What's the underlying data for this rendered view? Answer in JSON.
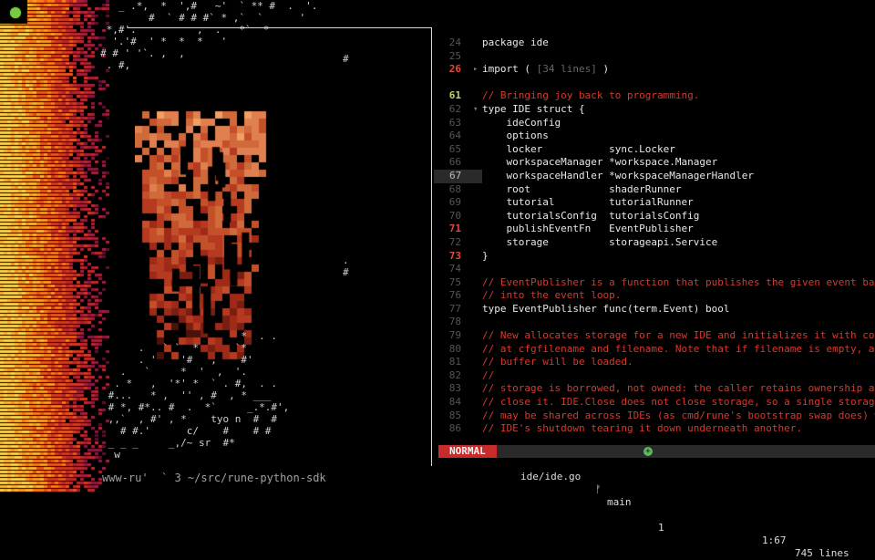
{
  "ascii_art": {
    "top": "   _ .*,  *  ',#   ~'  ` ** #  .  '.\n        #  ` # # #` * ,`  `      '\n *,#'.          ,  .   *`  *\n  '.'#  ' *  *  *   '\n# # ' '`. ,  ,\n . #,",
    "right": "#\n\n\n\n\n\n\n\n\n\n\n\n\n\n\n\n\n.\n#",
    "bottom": "                       *  . .\n      .   ` `  *      `*\n      . '    '#   ,    #'\n   .   `     *  '  ,  '.\n  . *   ,  '*' *  ` . #,  . .\n #...   * ,  '' , #  , * ___\n # *, #*.. #  .  *`     _.*.#',\n ,,`  , #' , *    tyo n  #  #\n   # #.'      c/    #    # #\n _ _ _     _,/~ sr  #*\n  w"
  },
  "shell": {
    "prompt": "www-ru'  ` 3 ~/src/rune-python-sdk"
  },
  "editor": {
    "lines": [
      {
        "n": "24",
        "style": "",
        "fold": "",
        "text": "package ide",
        "kind": "code"
      },
      {
        "n": "25",
        "style": "",
        "fold": "",
        "text": "",
        "kind": "code"
      },
      {
        "n": "26",
        "style": "hl",
        "fold": "▸",
        "text": "import ( ",
        "dim": "[34 lines]",
        "after": " )",
        "kind": "code"
      },
      {
        "n": "",
        "style": "",
        "fold": "",
        "text": "",
        "kind": "code"
      },
      {
        "n": "61",
        "style": "grn",
        "fold": "",
        "text": "// Bringing joy back to programming.",
        "kind": "comment"
      },
      {
        "n": "62",
        "style": "",
        "fold": "▾",
        "text": "type IDE struct {",
        "kind": "code"
      },
      {
        "n": "63",
        "style": "",
        "fold": "",
        "text": "    ideConfig",
        "kind": "code"
      },
      {
        "n": "64",
        "style": "",
        "fold": "",
        "text": "    options",
        "kind": "code"
      },
      {
        "n": "65",
        "style": "",
        "fold": "",
        "text": "    locker           sync.Locker",
        "kind": "code"
      },
      {
        "n": "66",
        "style": "",
        "fold": "",
        "text": "    workspaceManager *workspace.Manager",
        "kind": "code"
      },
      {
        "n": "67",
        "style": "cur",
        "fold": "",
        "text": "    workspaceHandler *workspaceManagerHandler",
        "kind": "code"
      },
      {
        "n": "68",
        "style": "",
        "fold": "",
        "text": "    root             shaderRunner",
        "kind": "code"
      },
      {
        "n": "69",
        "style": "",
        "fold": "",
        "text": "    tutorial         tutorialRunner",
        "kind": "code"
      },
      {
        "n": "70",
        "style": "",
        "fold": "",
        "text": "    tutorialsConfig  tutorialsConfig",
        "kind": "code"
      },
      {
        "n": "71",
        "style": "hl",
        "fold": "",
        "text": "    publishEventFn   EventPublisher",
        "kind": "code"
      },
      {
        "n": "72",
        "style": "",
        "fold": "",
        "text": "    storage          storageapi.Service",
        "kind": "code"
      },
      {
        "n": "73",
        "style": "hl",
        "fold": "",
        "text": "}",
        "kind": "code"
      },
      {
        "n": "74",
        "style": "",
        "fold": "",
        "text": "",
        "kind": "code"
      },
      {
        "n": "75",
        "style": "",
        "fold": "",
        "text": "// EventPublisher is a function that publishes the given event back",
        "kind": "comment"
      },
      {
        "n": "76",
        "style": "",
        "fold": "",
        "text": "// into the event loop.",
        "kind": "comment"
      },
      {
        "n": "77",
        "style": "",
        "fold": "",
        "text": "type EventPublisher func(term.Event) bool",
        "kind": "code"
      },
      {
        "n": "78",
        "style": "",
        "fold": "",
        "text": "",
        "kind": "code"
      },
      {
        "n": "79",
        "style": "",
        "fold": "",
        "text": "// New allocates storage for a new IDE and initializes it with config",
        "kind": "comment"
      },
      {
        "n": "80",
        "style": "",
        "fold": "",
        "text": "// at cfgfilename and filename. Note that if filename is empty, a default",
        "kind": "comment"
      },
      {
        "n": "81",
        "style": "",
        "fold": "",
        "text": "// buffer will be loaded.",
        "kind": "comment"
      },
      {
        "n": "82",
        "style": "",
        "fold": "",
        "text": "//",
        "kind": "comment"
      },
      {
        "n": "83",
        "style": "",
        "fold": "",
        "text": "// storage is borrowed, not owned: the caller retains ownership and must",
        "kind": "comment"
      },
      {
        "n": "84",
        "style": "",
        "fold": "",
        "text": "// close it. IDE.Close does not close storage, so a single storage handle",
        "kind": "comment"
      },
      {
        "n": "85",
        "style": "",
        "fold": "",
        "text": "// may be shared across IDEs (as cmd/rune's bootstrap swap does) without",
        "kind": "comment"
      },
      {
        "n": "86",
        "style": "",
        "fold": "",
        "text": "// IDE's shutdown tearing it down underneath another.",
        "kind": "comment"
      }
    ]
  },
  "statusline": {
    "mode": "NORMAL",
    "file": "ide/ide.go",
    "branch_icon": "branch-icon",
    "branch": "main",
    "diag_icon": "plus-circle-icon",
    "diag_symbol": "+",
    "diag_count": "1",
    "position": "1:67",
    "line_count": "745 lines"
  },
  "colors": {
    "accent_red": "#c92a2a",
    "comment_red": "#d23b2e",
    "status_green": "#5cb85c"
  }
}
